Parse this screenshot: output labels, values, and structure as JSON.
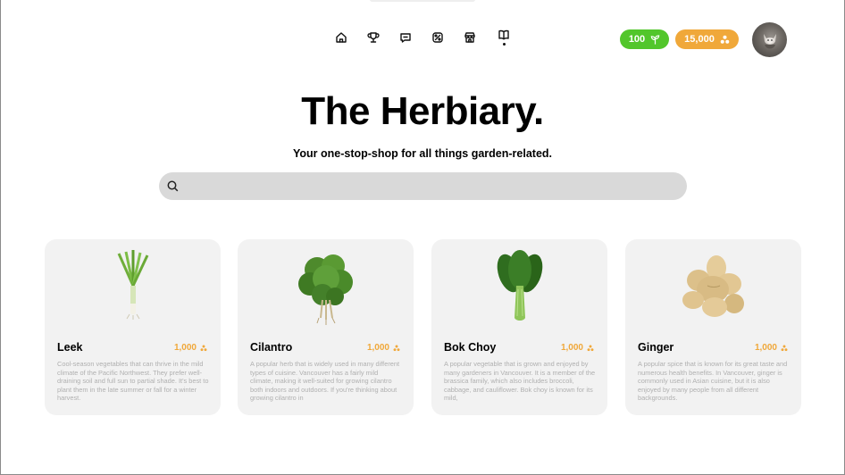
{
  "nav": {
    "items": [
      {
        "icon": "home-icon"
      },
      {
        "icon": "trophy-icon"
      },
      {
        "icon": "message-icon"
      },
      {
        "icon": "badge-icon"
      },
      {
        "icon": "store-icon"
      },
      {
        "icon": "book-icon",
        "active": true
      }
    ]
  },
  "header": {
    "points": "100",
    "points_icon": "sprout-icon",
    "coins": "15,000",
    "coins_icon": "coins-icon",
    "accent_green": "#52c62b",
    "accent_orange": "#f0a83a"
  },
  "hero": {
    "title": "The Herbiary.",
    "subtitle": "Your one-stop-shop for all things garden-related.",
    "search_placeholder": ""
  },
  "cards": [
    {
      "name": "Leek",
      "price": "1,000",
      "description": "Cool-season vegetables that can thrive in the mild climate of the Pacific Northwest. They prefer well-draining soil and full sun to partial shade. It's best to plant them in the late summer or fall for a winter harvest."
    },
    {
      "name": "Cilantro",
      "price": "1,000",
      "description": "A popular herb that is widely used in many different types of cuisine. Vancouver has a fairly mild climate, making it well-suited for growing cilantro both indoors and outdoors. If you're thinking about growing cilantro in"
    },
    {
      "name": "Bok Choy",
      "price": "1,000",
      "description": "A popular vegetable that is grown and enjoyed by many gardeners in Vancouver. It is a member of the brassica family, which also includes broccoli, cabbage, and cauliflower. Bok choy is known for its mild,"
    },
    {
      "name": "Ginger",
      "price": "1,000",
      "description": "A popular spice that is known for its great taste and numerous health benefits. In Vancouver, ginger is commonly used in Asian cuisine, but it is also enjoyed by many people from all different backgrounds."
    }
  ]
}
